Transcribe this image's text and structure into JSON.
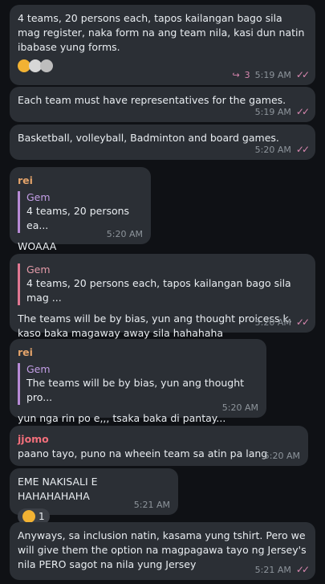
{
  "messages": [
    {
      "text": "4 teams, 20 persons each, tapos kailangan bago sila mag register, naka form na ang team nila, kasi dun natin ibabase yung forms.",
      "reply_count": "3",
      "time": "5:19 AM",
      "reactions": [
        "hand-emoji",
        "avatar-emoji",
        "face-emoji"
      ]
    },
    {
      "text": "Each team must have representatives for the games.",
      "time": "5:19 AM"
    },
    {
      "text": "Basketball, volleyball, Badminton and board games.",
      "time": "5:20 AM"
    },
    {
      "sender": "rei",
      "reply_to": {
        "name": "Gem",
        "text": "4 teams, 20 persons ea..."
      },
      "text": "WOAAA",
      "time": "5:20 AM"
    },
    {
      "reply_to": {
        "name": "Gem",
        "text": "4 teams, 20 persons each, tapos kailangan bago sila mag ..."
      },
      "text": "The teams will be by bias, yun ang thought proicess k, kaso baka magaway away sila hahahaha",
      "time": "5:20 AM"
    },
    {
      "sender": "rei",
      "reply_to": {
        "name": "Gem",
        "text": "The teams will be by bias, yun ang thought pro..."
      },
      "text": "yun nga rin po e,,, tsaka baka di pantay...",
      "time": "5:20 AM"
    },
    {
      "sender": "jjomo",
      "text": "paano tayo, puno na wheein team sa atin pa lang",
      "time": "5:20 AM"
    },
    {
      "text": "EME NAKISALI E HAHAHAHAHA",
      "reaction": {
        "emoji": "laughing-face-icon",
        "count": "1"
      },
      "time": "5:21 AM"
    },
    {
      "text": "Anyways, sa inclusion natin, kasama yung tshirt. Pero we will give them the option na magpagawa tayo ng Jersey's nila PERO sagot na nila yung Jersey",
      "time": "5:21 AM"
    }
  ],
  "colors": {
    "background": "#0f1115",
    "bubble": "#2b2f35",
    "sender_rei": "#e3a36a",
    "sender_jjomo": "#f26f7b",
    "reply_bar": "#b78ad6",
    "ticks": "#d987b0"
  }
}
